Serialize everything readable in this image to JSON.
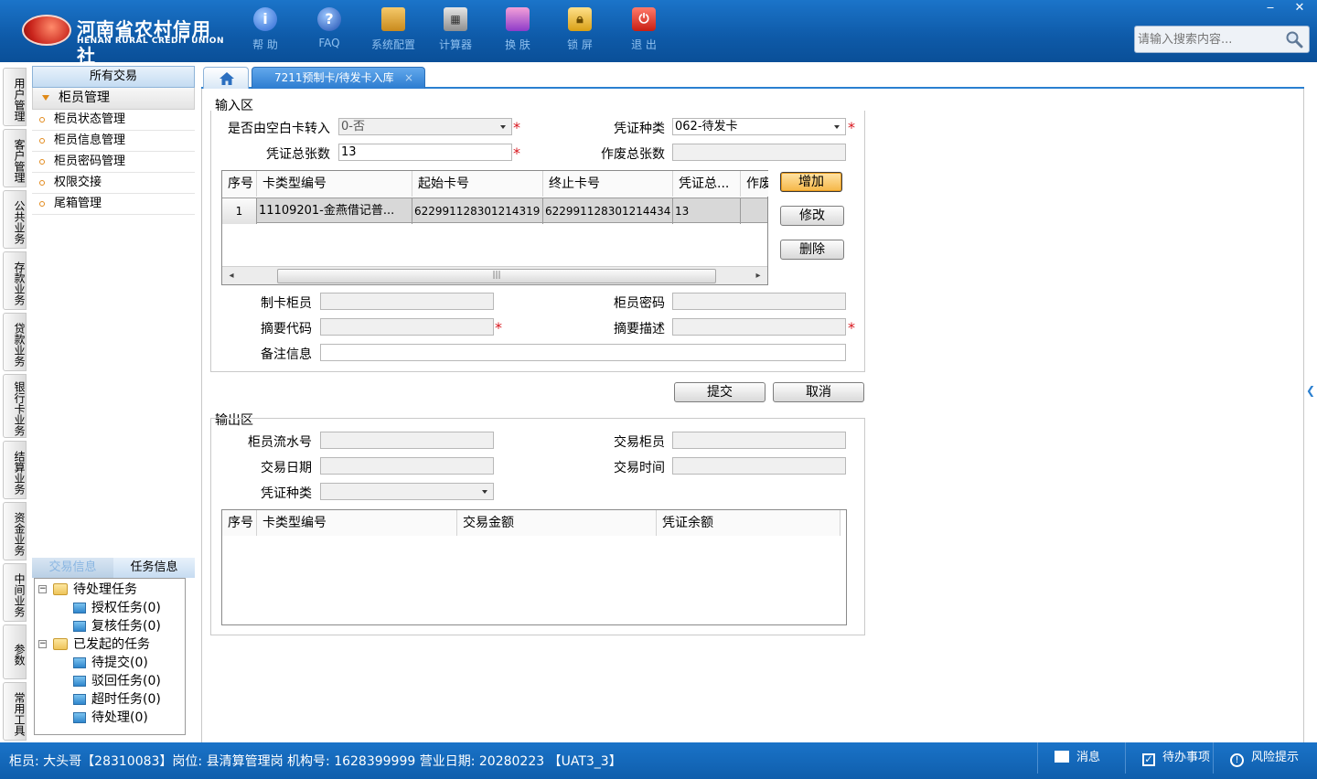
{
  "app": {
    "logo_cn": "河南省农村信用社",
    "logo_en": "HENAN RURAL CREDIT UNION"
  },
  "toolbar": [
    {
      "label": "帮 助",
      "icon": "info-icon"
    },
    {
      "label": "FAQ",
      "icon": "question-icon"
    },
    {
      "label": "系统配置",
      "icon": "toolbox-icon"
    },
    {
      "label": "计算器",
      "icon": "calculator-icon"
    },
    {
      "label": "换 肤",
      "icon": "shirt-icon"
    },
    {
      "label": "锁 屏",
      "icon": "lock-icon"
    },
    {
      "label": "退 出",
      "icon": "power-icon"
    }
  ],
  "search": {
    "placeholder": "请输入搜索内容..."
  },
  "vtabs": [
    "用户管理",
    "客户管理",
    "公共业务",
    "存款业务",
    "贷款业务",
    "银行卡业务",
    "结算业务",
    "资金业务",
    "中间业务",
    "参数",
    "常用工具"
  ],
  "sidebar": {
    "header": "所有交易",
    "group": "柜员管理",
    "items": [
      "柜员状态管理",
      "柜员信息管理",
      "柜员密码管理",
      "权限交接",
      "尾箱管理"
    ]
  },
  "tasks": {
    "tab1": "交易信息",
    "tab2": "任务信息",
    "tree": [
      {
        "label": "待处理任务",
        "level": 0
      },
      {
        "label": "授权任务(0)",
        "level": 1
      },
      {
        "label": "复核任务(0)",
        "level": 1
      },
      {
        "label": "已发起的任务",
        "level": 0
      },
      {
        "label": "待提交(0)",
        "level": 1
      },
      {
        "label": "驳回任务(0)",
        "level": 1
      },
      {
        "label": "超时任务(0)",
        "level": 1
      },
      {
        "label": "待处理(0)",
        "level": 1
      }
    ]
  },
  "tabs": {
    "active": "7211预制卡/待发卡入库",
    "close": "×"
  },
  "input": {
    "section": "输入区",
    "blank_card_label": "是否由空白卡转入",
    "blank_card_value": "0-否",
    "voucher_type_label": "凭证种类",
    "voucher_type_value": "062-待发卡",
    "voucher_total_label": "凭证总张数",
    "voucher_total_value": "13",
    "void_total_label": "作废总张数",
    "void_total_value": "",
    "grid": {
      "headers": [
        "序号",
        "卡类型编号",
        "起始卡号",
        "终止卡号",
        "凭证总...",
        "作废"
      ],
      "rows": [
        [
          "1",
          "11109201-金燕借记普...",
          "622991128301214319",
          "622991128301214434",
          "13",
          ""
        ]
      ]
    },
    "add": "增加",
    "edit": "修改",
    "delete": "删除",
    "maker_label": "制卡柜员",
    "password_label": "柜员密码",
    "summary_code_label": "摘要代码",
    "summary_desc_label": "摘要描述",
    "remark_label": "备注信息",
    "submit": "提交",
    "cancel": "取消"
  },
  "output": {
    "section": "输出区",
    "serial_label": "柜员流水号",
    "teller_label": "交易柜员",
    "date_label": "交易日期",
    "time_label": "交易时间",
    "voucher_type_label": "凭证种类",
    "grid_headers": [
      "序号",
      "卡类型编号",
      "交易金额",
      "凭证余额"
    ]
  },
  "status": {
    "text": "柜员: 大头哥【28310083】岗位: 县清算管理岗  机构号: 1628399999  营业日期: 20280223  【UAT3_3】",
    "msg": "消息",
    "todo": "待办事项",
    "risk": "风险提示"
  },
  "colors": {
    "brand": "#0e5aa8",
    "accent": "#f5b646",
    "required": "#d8161d"
  }
}
